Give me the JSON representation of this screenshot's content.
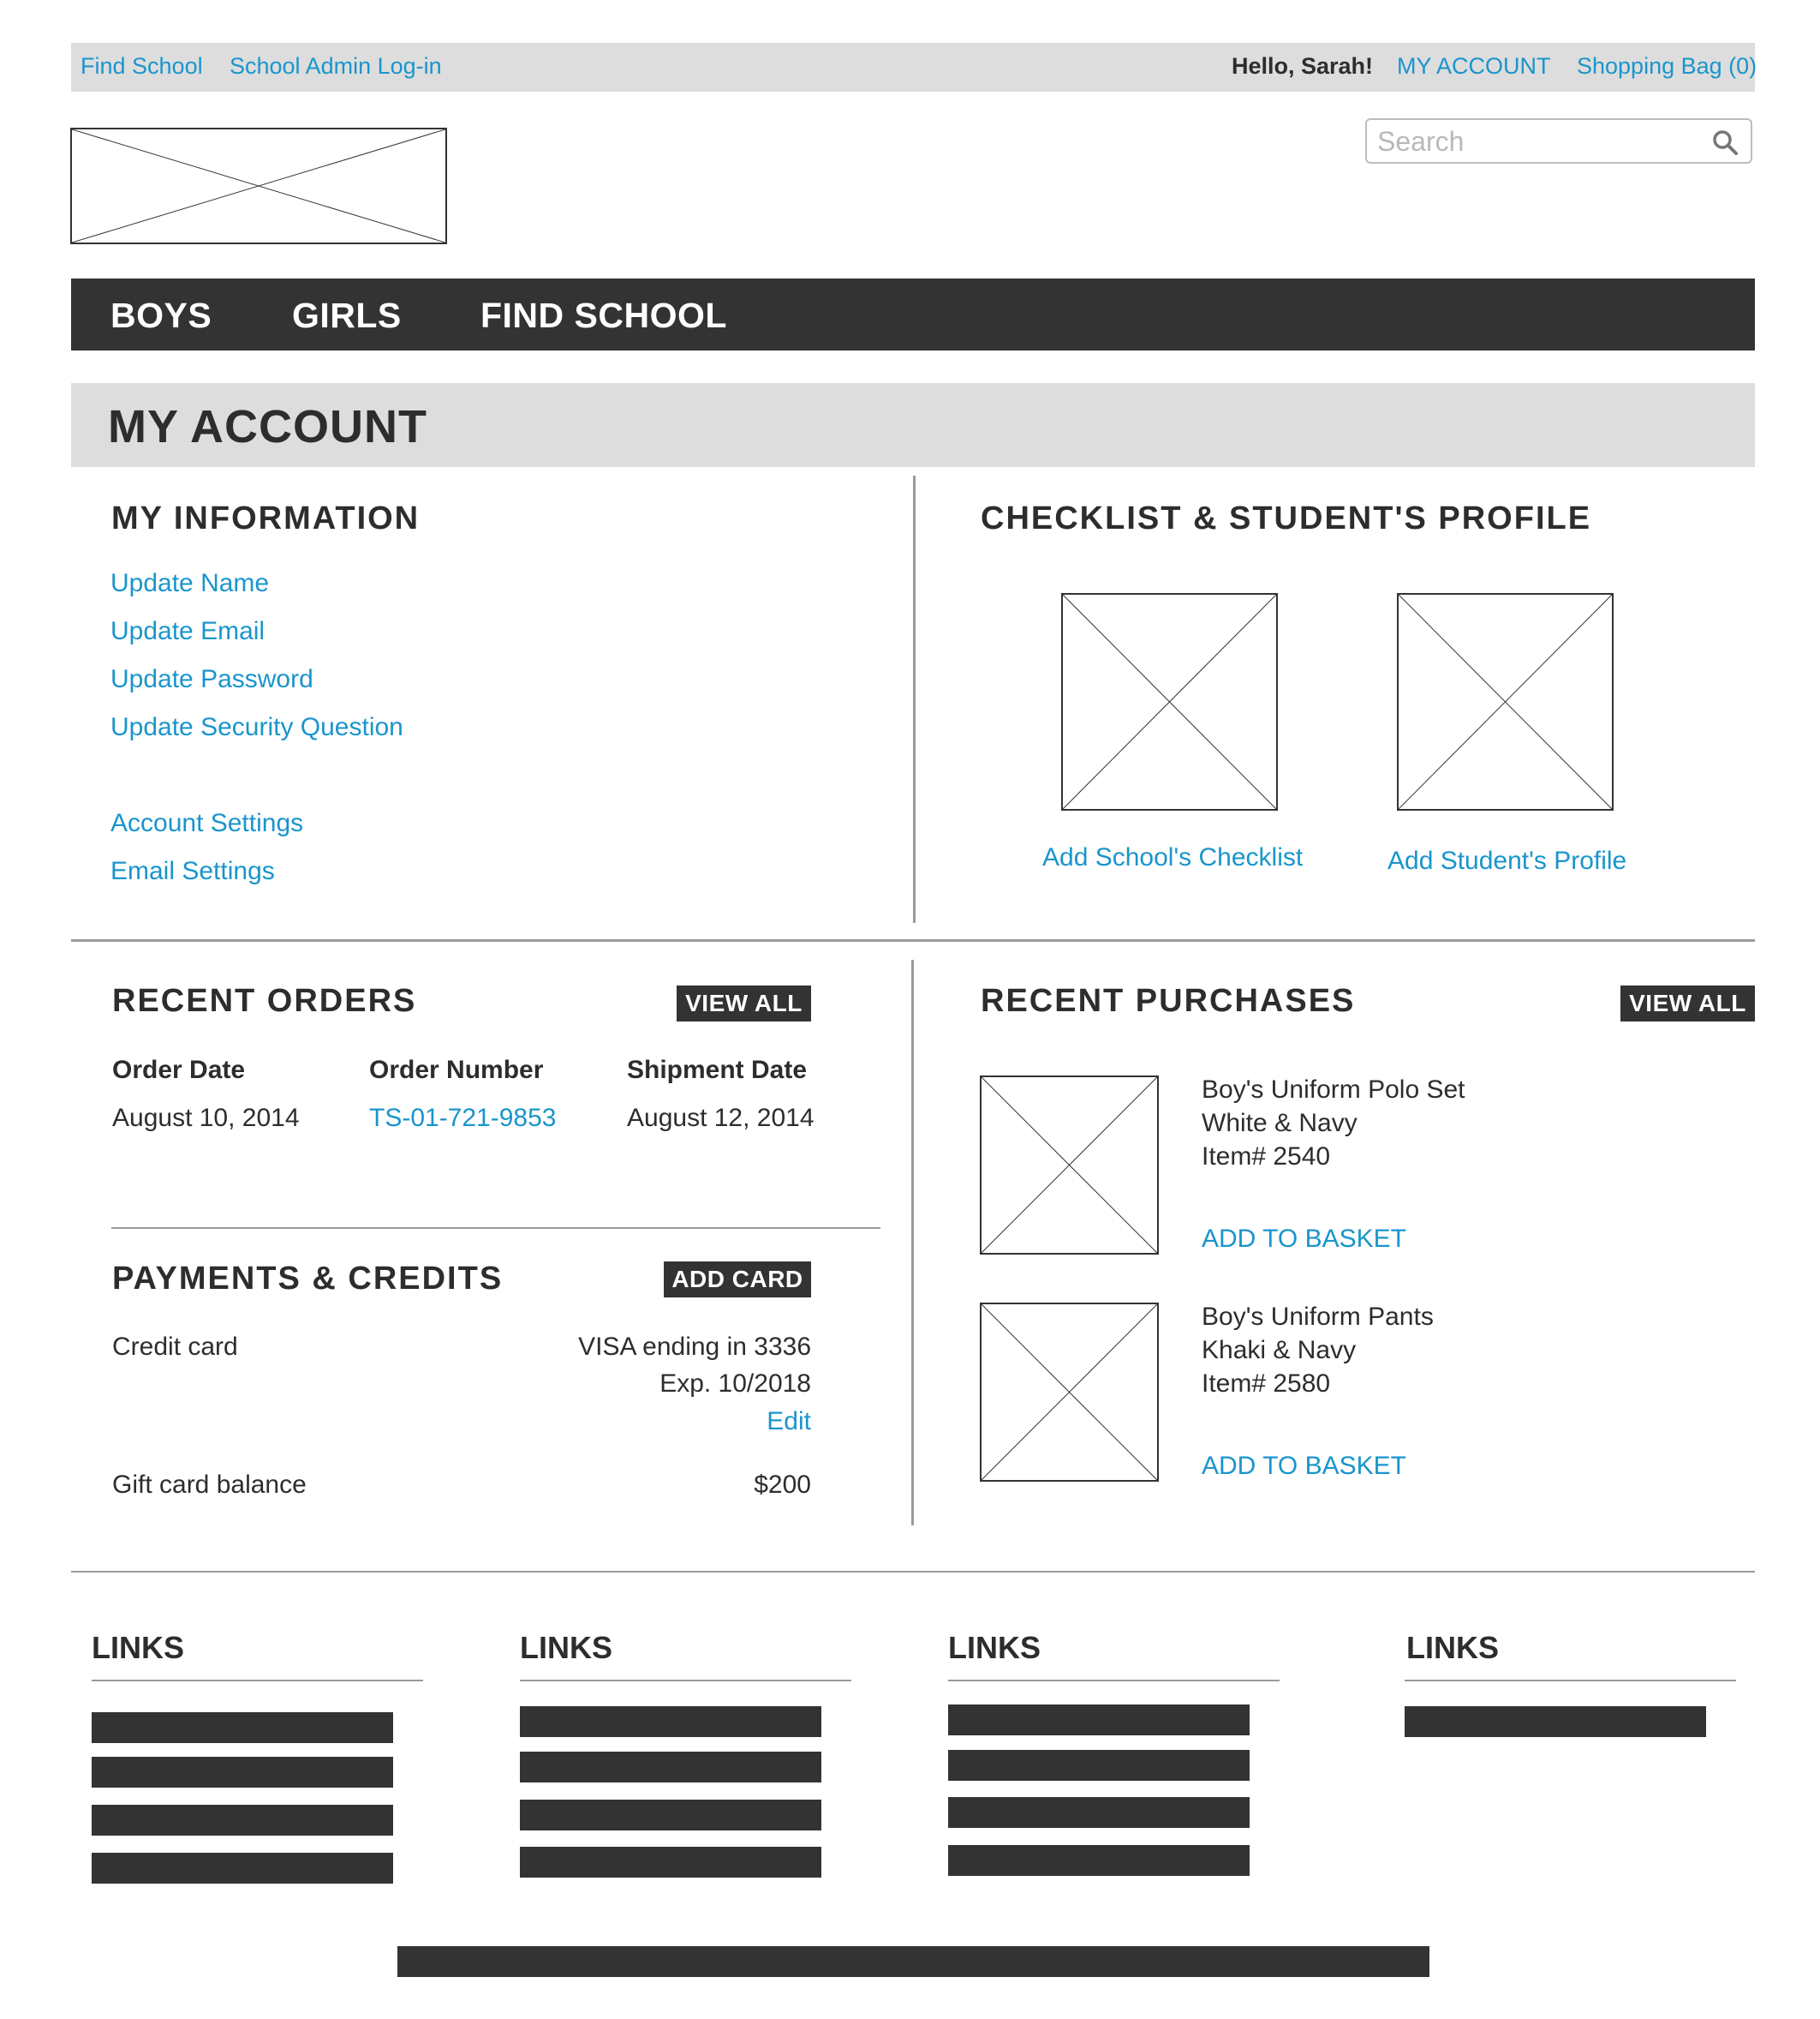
{
  "utility": {
    "find_school": "Find School",
    "admin_login": "School Admin Log-in",
    "greeting": "Hello, Sarah!",
    "my_account": "MY ACCOUNT",
    "shopping_bag": "Shopping Bag (0)"
  },
  "search": {
    "placeholder": "Search"
  },
  "nav": {
    "boys": "BOYS",
    "girls": "GIRLS",
    "find_school": "FIND SCHOOL"
  },
  "page": {
    "title": "MY ACCOUNT"
  },
  "my_information": {
    "title": "MY INFORMATION",
    "links": [
      "Update Name",
      "Update Email",
      "Update Password",
      "Update Security Question",
      "Account Settings",
      "Email Settings"
    ]
  },
  "checklist": {
    "title": "CHECKLIST & STUDENT'S PROFILE",
    "add_checklist": "Add School's Checklist",
    "add_profile": "Add Student's Profile"
  },
  "recent_orders": {
    "title": "RECENT ORDERS",
    "view_all": "VIEW ALL",
    "headers": [
      "Order Date",
      "Order Number",
      "Shipment Date"
    ],
    "row": [
      "August 10, 2014",
      "TS-01-721-9853",
      "August 12, 2014"
    ]
  },
  "payments": {
    "title": "PAYMENTS & CREDITS",
    "add_card": "ADD CARD",
    "credit_label": "Credit card",
    "card_desc": "VISA ending in 3336",
    "card_exp": "Exp. 10/2018",
    "edit": "Edit",
    "gift_label": "Gift card balance",
    "gift_value": "$200"
  },
  "recent_purchases": {
    "title": "RECENT PURCHASES",
    "view_all": "VIEW ALL",
    "items": [
      {
        "name": "Boy's Uniform Polo Set",
        "color": "White & Navy",
        "item": "Item# 2540",
        "action": "ADD TO BASKET"
      },
      {
        "name": "Boy's Uniform Pants",
        "color": "Khaki & Navy",
        "item": "Item# 2580",
        "action": "ADD TO BASKET"
      }
    ]
  },
  "footer": {
    "link_titles": [
      "LINKS",
      "LINKS",
      "LINKS",
      "LINKS"
    ]
  }
}
